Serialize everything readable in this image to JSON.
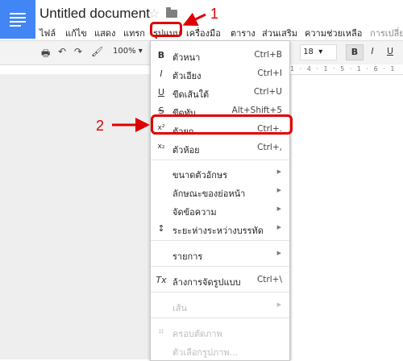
{
  "header": {
    "title": "Untitled document",
    "star_icon": "star-icon",
    "folder_icon": "folder-icon"
  },
  "menubar": {
    "items": [
      "ไฟล์",
      "แก้ไข",
      "แสดง",
      "แทรก",
      "รูปแบบ",
      "เครื่องมือ",
      "ตาราง",
      "ส่วนเสริม",
      "ความช่วยเหลือ",
      "การเปลี่ย"
    ]
  },
  "toolbar": {
    "zoom": "100%",
    "font_size": "18",
    "bold": "B",
    "italic": "I",
    "underline": "U"
  },
  "ruler": {
    "text": "1 · 4 · 1 · 5 · 1 · 6 · 1"
  },
  "format_menu": {
    "items": [
      {
        "icon": "B",
        "label": "ตัวหนา",
        "shortcut": "Ctrl+B"
      },
      {
        "icon": "I",
        "label": "ตัวเอียง",
        "shortcut": "Ctrl+I"
      },
      {
        "icon": "U",
        "label": "ขีดเส้นใต้",
        "shortcut": "Ctrl+U"
      },
      {
        "icon": "S",
        "label": "ขีดทับ",
        "shortcut": "Alt+Shift+5"
      },
      {
        "icon": "x²",
        "label": "ตัวยก",
        "shortcut": "Ctrl+."
      },
      {
        "icon": "x₂",
        "label": "ตัวห้อย",
        "shortcut": "Ctrl+,"
      },
      {
        "icon": "",
        "label": "ขนาดตัวอักษร",
        "shortcut": ""
      },
      {
        "icon": "",
        "label": "ลักษณะของย่อหน้า",
        "shortcut": ""
      },
      {
        "icon": "",
        "label": "จัดข้อความ",
        "shortcut": ""
      },
      {
        "icon": "↕",
        "label": "ระยะห่างระหว่างบรรทัด",
        "shortcut": ""
      },
      {
        "icon": "",
        "label": "รายการ",
        "shortcut": ""
      },
      {
        "icon": "Tx",
        "label": "ล้างการจัดรูปแบบ",
        "shortcut": "Ctrl+\\"
      },
      {
        "icon": "",
        "label": "เส้น",
        "shortcut": ""
      },
      {
        "icon": "⌗",
        "label": "ครอบตัดภาพ",
        "shortcut": ""
      },
      {
        "icon": "",
        "label": "ตัวเลือกรูปภาพ...",
        "shortcut": ""
      }
    ]
  },
  "annotations": {
    "step1": "1",
    "step2": "2",
    "color": "#e00000"
  }
}
